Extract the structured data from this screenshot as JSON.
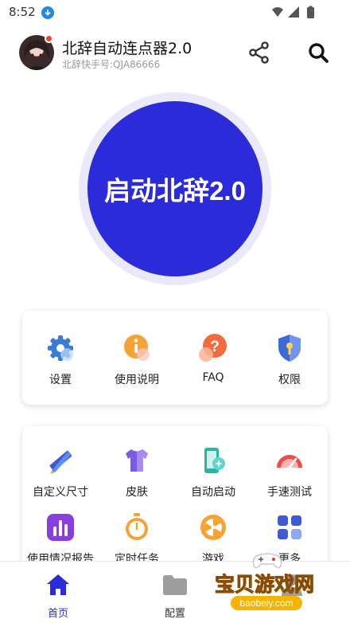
{
  "status_bar": {
    "time": "8:52"
  },
  "header": {
    "title": "北辞自动连点器2.0",
    "subtitle": "北辞快手号:QJA86666"
  },
  "main_action": {
    "label": "启动北辞2.0"
  },
  "quick_menu": [
    {
      "label": "设置",
      "icon": "gear-icon"
    },
    {
      "label": "使用说明",
      "icon": "info-icon"
    },
    {
      "label": "FAQ",
      "icon": "question-icon"
    },
    {
      "label": "权限",
      "icon": "shield-icon"
    }
  ],
  "tools_menu": [
    {
      "label": "自定义尺寸",
      "icon": "ruler-pencil-icon"
    },
    {
      "label": "皮肤",
      "icon": "shirt-icon"
    },
    {
      "label": "自动启动",
      "icon": "phone-link-icon"
    },
    {
      "label": "手速测试",
      "icon": "speedometer-icon"
    },
    {
      "label": "使用情况报告",
      "icon": "bar-chart-icon"
    },
    {
      "label": "定时任务",
      "icon": "stopwatch-icon"
    },
    {
      "label": "游戏",
      "icon": "wheel-icon"
    },
    {
      "label": "更多",
      "icon": "grid-icon"
    }
  ],
  "bottom_nav": [
    {
      "label": "首页",
      "icon": "home-icon",
      "active": true
    },
    {
      "label": "配置",
      "icon": "folder-icon",
      "active": false
    },
    {
      "label": "",
      "icon": "profile-icon",
      "active": false
    }
  ],
  "watermark": {
    "text": "宝贝游戏网",
    "url": "baobeiy.com"
  },
  "colors": {
    "accent": "#2b2bd9",
    "ring": "#e9e9f9"
  }
}
